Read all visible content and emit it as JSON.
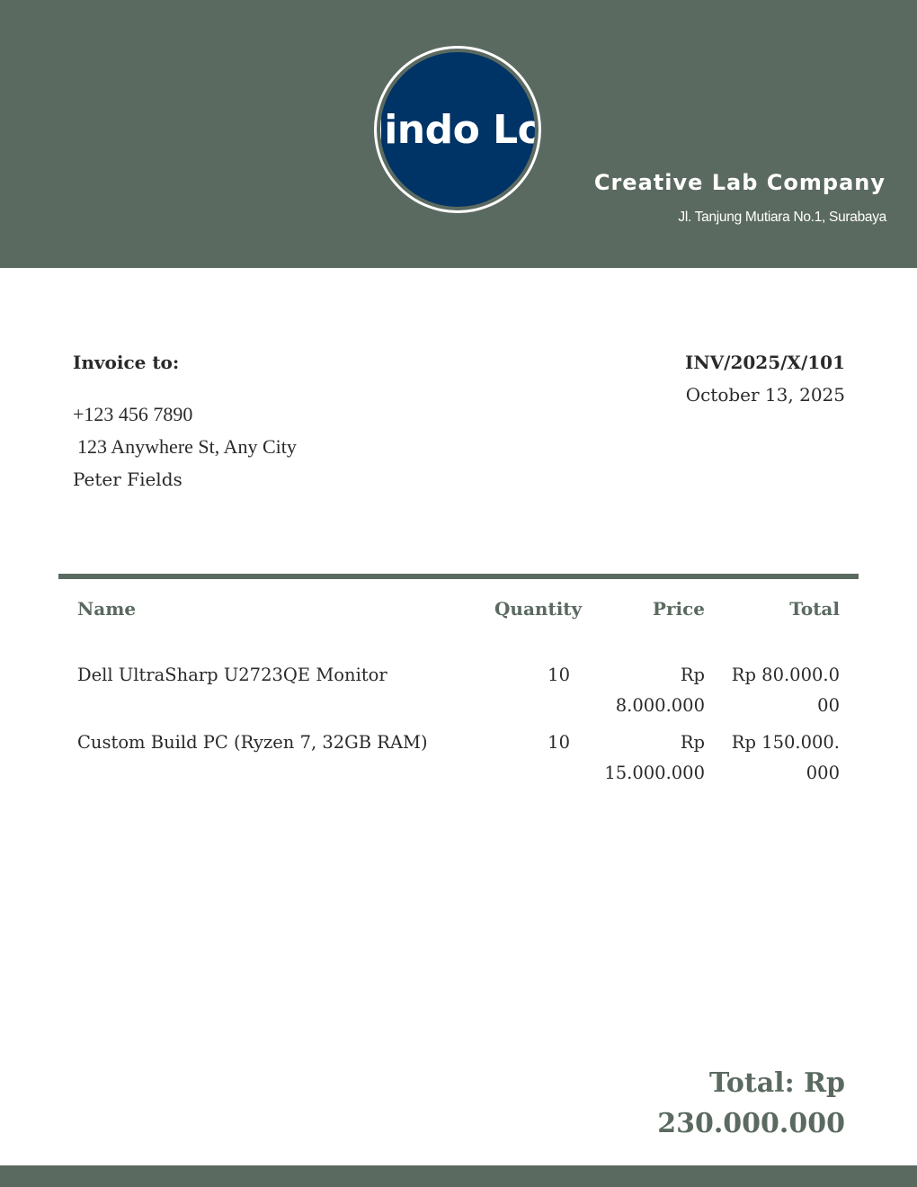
{
  "header": {
    "logo_text": "lindo Lo",
    "company_name": "Creative Lab Company",
    "company_address": "Jl. Tanjung Mutiara No.1, Surabaya"
  },
  "invoice": {
    "to_label": "Invoice to:",
    "phone": "+123 456 7890",
    "address": "123 Anywhere St, Any City",
    "client_name": "Peter Fields",
    "number": "INV/2025/X/101",
    "date": "October 13, 2025"
  },
  "table": {
    "headers": {
      "name": "Name",
      "quantity": "Quantity",
      "price": "Price",
      "total": "Total"
    },
    "rows": [
      {
        "name": "Dell UltraSharp U2723QE Monitor",
        "quantity": "10",
        "price": "Rp 8.000.000",
        "total": "Rp 80.000.000"
      },
      {
        "name": "Custom Build PC (Ryzen 7, 32GB RAM)",
        "quantity": "10",
        "price": "Rp 15.000.000",
        "total": "Rp 150.000.000"
      }
    ]
  },
  "summary": {
    "total_label": "Total: Rp 230.000.000"
  },
  "colors": {
    "accent": "#5b6a60",
    "logo_fill": "#003366"
  }
}
